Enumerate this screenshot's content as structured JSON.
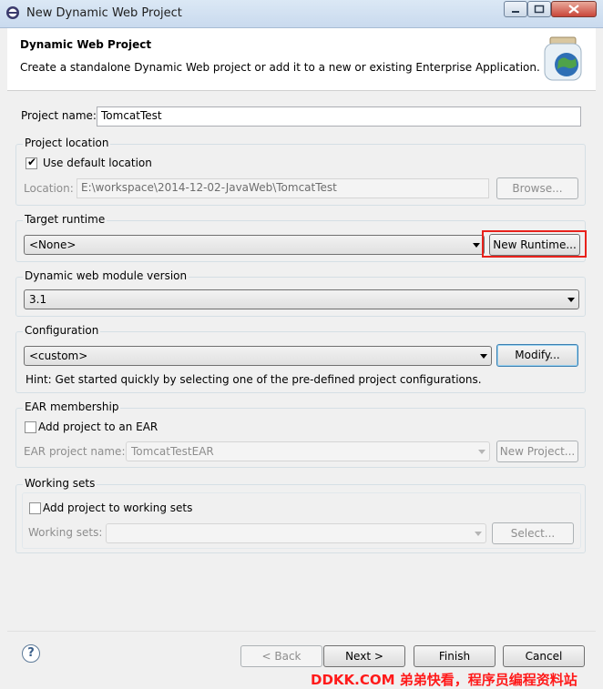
{
  "window": {
    "title": "New Dynamic Web Project"
  },
  "header": {
    "title": "Dynamic Web Project",
    "description": "Create a standalone Dynamic Web project or add it to a new or existing Enterprise Application."
  },
  "project_name": {
    "label": "Project name:",
    "value": "TomcatTest"
  },
  "project_location": {
    "group_title": "Project location",
    "use_default_label": "Use default location",
    "use_default_checked": true,
    "location_label": "Location:",
    "location_value": "E:\\workspace\\2014-12-02-JavaWeb\\TomcatTest",
    "browse_label": "Browse..."
  },
  "target_runtime": {
    "group_title": "Target runtime",
    "selected": "<None>",
    "new_runtime_label": "New Runtime..."
  },
  "module_version": {
    "group_title": "Dynamic web module version",
    "selected": "3.1"
  },
  "configuration": {
    "group_title": "Configuration",
    "selected": "<custom>",
    "modify_label": "Modify...",
    "hint": "Hint: Get started quickly by selecting one of the pre-defined project configurations."
  },
  "ear": {
    "group_title": "EAR membership",
    "add_label": "Add project to an EAR",
    "add_checked": false,
    "project_name_label": "EAR project name:",
    "project_name_value": "TomcatTestEAR",
    "new_project_label": "New Project..."
  },
  "working_sets": {
    "group_title": "Working sets",
    "add_label": "Add project to working sets",
    "add_checked": false,
    "sets_label": "Working sets:",
    "sets_value": "",
    "select_label": "Select..."
  },
  "footer": {
    "help_glyph": "?",
    "back_label": "< Back",
    "next_label": "Next >",
    "finish_label": "Finish",
    "cancel_label": "Cancel"
  },
  "watermark": "DDKK.COM 弟弟快看，程序员编程资料站",
  "colors": {
    "highlight_border": "#e8211b",
    "watermark": "#ff1a1a"
  }
}
